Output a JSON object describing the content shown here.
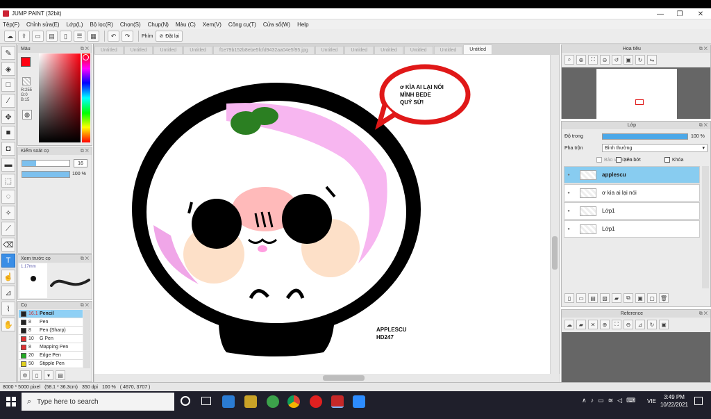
{
  "window": {
    "title": "JUMP PAINT (32bit)",
    "min": "—",
    "max": "❐",
    "close": "✕"
  },
  "menu": [
    "Tệp(F)",
    "Chỉnh sửa(E)",
    "Lớp(L)",
    "Bộ lọc(R)",
    "Chọn(S)",
    "Chụp(N)",
    "Màu (C)",
    "Xem(V)",
    "Công cụ(T)",
    "Cửa sổ(W)",
    "Help"
  ],
  "toolbar": {
    "phim_label": "Phím",
    "reset_label": "Đặt lại"
  },
  "tabs": [
    "Untitled",
    "Untitled",
    "Untitled",
    "Untitled",
    "f1e79b152b8ebe5fcfd9432aa04e5f95.jpg",
    "Untitled",
    "Untitled",
    "Untitled",
    "Untitled",
    "Untitled",
    "Untitled",
    "Untitled"
  ],
  "color_panel": {
    "title": "Màu",
    "r": "R:255",
    "g": "G:0",
    "b": "B:15",
    "primary": "#ff0010",
    "secondary": "#444444"
  },
  "brush_control": {
    "title": "Kiểm soát cọ",
    "size": "16",
    "opacity": "100 %"
  },
  "brush_preview": {
    "title": "Xem trước cọ",
    "size_label": "1.17mm"
  },
  "brush_list": {
    "title": "Cọ",
    "items": [
      {
        "size": "16.1",
        "name": "Pencil",
        "color": "#222222"
      },
      {
        "size": "8",
        "name": "Pen",
        "color": "#222222"
      },
      {
        "size": "8",
        "name": "Pen (Sharp)",
        "color": "#222222"
      },
      {
        "size": "10",
        "name": "G Pen",
        "color": "#e03030"
      },
      {
        "size": "8",
        "name": "Mapping Pen",
        "color": "#e03030"
      },
      {
        "size": "20",
        "name": "Edge Pen",
        "color": "#22aa22"
      },
      {
        "size": "50",
        "name": "Stipple Pen",
        "color": "#e0d020"
      }
    ]
  },
  "canvas": {
    "speech_text": [
      "ơ KÌA   AI LẠI NÓI",
      "MÌNH BEDE",
      "QUỶ SỨ!"
    ],
    "signature": [
      "APPLESCU",
      "HD247"
    ]
  },
  "navigator": {
    "title": "Hoa tiêu"
  },
  "layer_panel": {
    "title": "Lớp",
    "opacity_label": "Độ trong",
    "opacity_value": "100 %",
    "blend_label": "Pha trộn",
    "blend_value": "Bình thường",
    "protect_alpha": "Bảo vệ alpha",
    "clip": "Xén bớt",
    "lock": "Khóa",
    "layers": [
      {
        "name": "applescu",
        "selected": true
      },
      {
        "name": "ơ kìa  ai lại nói",
        "selected": false
      },
      {
        "name": "Lớp1",
        "selected": false
      },
      {
        "name": "Lớp1",
        "selected": false
      }
    ]
  },
  "reference": {
    "title": "Reference"
  },
  "status": {
    "size": "8000 * 5000 pixel",
    "cm": "(58.1 * 36.3cm)",
    "dpi": "350 dpi",
    "zoom": "100 %",
    "coords": "( 4670, 3707 )"
  },
  "taskbar": {
    "search_placeholder": "Type here to search",
    "time": "3:49 PM",
    "date": "10/22/2021",
    "lang": "VIE"
  }
}
